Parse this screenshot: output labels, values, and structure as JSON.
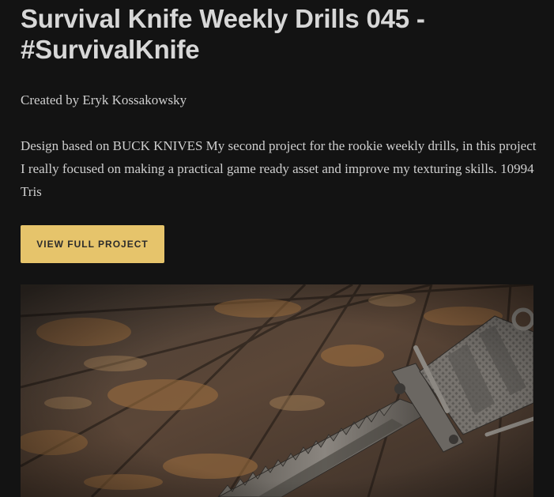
{
  "project": {
    "title": "Survival Knife Weekly Drills 045 - #SurvivalKnife",
    "byline": "Created by Eryk Kossakowsky",
    "description": "Design based on BUCK KNIVES My second project for the rookie weekly drills, in this project I really focused on making a practical game ready asset and improve my texturing skills. 10994 Tris",
    "cta_label": "VIEW FULL PROJECT",
    "hero_image": "survival-knife-render"
  },
  "colors": {
    "background": "#131313",
    "text": "#d7d7d7",
    "accent": "#e6c46b"
  }
}
